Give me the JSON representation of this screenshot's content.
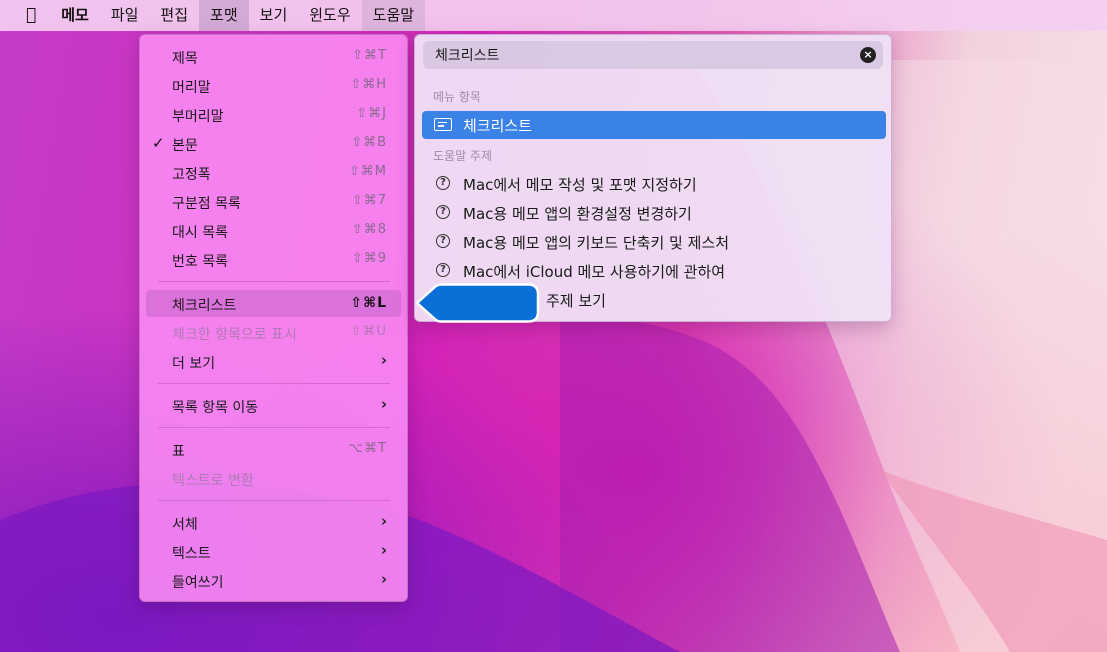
{
  "menubar": {
    "apple_glyph": "",
    "items": [
      "메모",
      "파일",
      "편집",
      "포맷",
      "보기",
      "윈도우",
      "도움말"
    ]
  },
  "format_menu": {
    "items": [
      {
        "label": "제목",
        "shortcut": "⇧⌘T"
      },
      {
        "label": "머리말",
        "shortcut": "⇧⌘H"
      },
      {
        "label": "부머리말",
        "shortcut": "⇧⌘J"
      },
      {
        "label": "본문",
        "shortcut": "⇧⌘B",
        "checked": true
      },
      {
        "label": "고정폭",
        "shortcut": "⇧⌘M"
      },
      {
        "label": "구분점 목록",
        "shortcut": "⇧⌘7"
      },
      {
        "label": "대시 목록",
        "shortcut": "⇧⌘8"
      },
      {
        "label": "번호 목록",
        "shortcut": "⇧⌘9"
      },
      {
        "label": "체크리스트",
        "shortcut": "⇧⌘L",
        "highlighted": true
      },
      {
        "label": "체크한 항목으로 표시",
        "shortcut": "⇧⌘U",
        "disabled": true
      },
      {
        "label": "더 보기",
        "submenu": "›"
      },
      {
        "label": "목록 항목 이동",
        "submenu": "›"
      },
      {
        "label": "표",
        "shortcut": "⌥⌘T"
      },
      {
        "label": "텍스트로 변환",
        "disabled": true
      },
      {
        "label": "서체",
        "submenu": "›"
      },
      {
        "label": "텍스트",
        "submenu": "›"
      },
      {
        "label": "들여쓰기",
        "submenu": "›"
      }
    ],
    "check_glyph": "✓"
  },
  "help": {
    "search_value": "체크리스트",
    "clear_glyph": "×",
    "menu_section_title": "메뉴 항목",
    "menu_result": "체크리스트",
    "topics_section_title": "도움말 주제",
    "topic_icon_glyph": "?",
    "topics": [
      "Mac에서 메모 작성 및 포맷 지정하기",
      "Mac용 메모 앱의 환경설정 변경하기",
      "Mac용 메모 앱의 키보드 단축키 및 제스처",
      "Mac에서 iCloud 메모 사용하기에 관하여"
    ],
    "show_all_partial": "주제 보기"
  },
  "colors": {
    "accent": "#3b82e6",
    "pointer": "#0a6fd6"
  }
}
